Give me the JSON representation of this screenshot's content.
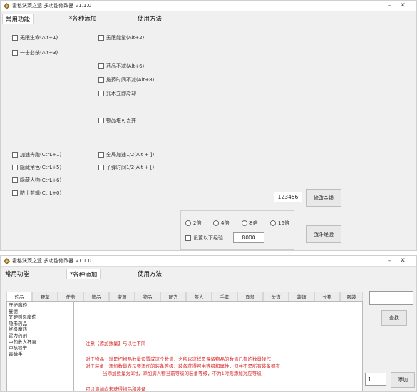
{
  "colors": {
    "window_bg": "#f0f0f0",
    "accent_red": "#d82b2b",
    "text": "#222222"
  },
  "window1": {
    "title": "霍格沃茨之遗 多功能修改器 V1.1.0",
    "tabs": [
      "常用功能",
      "*各种添加",
      "使用方法"
    ],
    "checkboxes_left": [
      "无限生命(Alt+1)",
      "一击必杀(Alt+3)"
    ],
    "checkboxes_right": [
      "无限能量(Alt+2)",
      "药品不减(Alt+6)",
      "施药时间不减(Alt+8)",
      "咒术立即冷却",
      "物品堆可丢弃"
    ],
    "checkboxes_bottom_left": [
      "加速奔跑(CtrL+1)",
      "隐藏角色(CtrL+5)",
      "隐藏人物(CtrL+6)",
      "防止剪辑(CtrL+0)"
    ],
    "checkboxes_bottom_right": [
      "全局加速1/2(Alt + ])",
      "子弹时间1/2(Alt + [)"
    ],
    "gold_value": "123456",
    "gold_button": "修改金钱",
    "multipliers": [
      "2倍",
      "4倍",
      "8倍",
      "16倍"
    ],
    "exp_checkbox": "设置以下经验",
    "exp_value": "8000",
    "exp_button": "战斗经验"
  },
  "window2": {
    "title": "霍格沃茨之遗 多功能修改器 V1.1.0",
    "tabs": [
      "常用功能",
      "*各种添加",
      "使用方法"
    ],
    "categories": [
      "药品",
      "野草",
      "任务",
      "饰品",
      "资源",
      "物品",
      "配方",
      "盔人",
      "手套",
      "面部",
      "头饰",
      "装饰",
      "长袍",
      "服装"
    ],
    "list_items": [
      "守护魔药",
      "曼德",
      "又硬则恩魔药",
      "隐形药品",
      "终极魔药",
      "霍力药剂",
      "中药收人狂喜",
      "审核检举",
      "毒触手"
    ],
    "description_lines": [
      "注意【添加数量】与以往不同",
      "对于物品：就是把物品数量设置成这个数值，之所以这样是保留物品的数值已有的数量操作",
      "对于装备：添加数量表示要添加的装备等级，装备获得可由等级和属性，但并不是所有装备都有",
      "当添加数量为1时，添加满人物当前等级的装备等级，不为1时则添加对应等级",
      "可以添加尚未获得物品和装备"
    ],
    "search_button": "查找",
    "quantity_value": "1",
    "add_button": "添加"
  }
}
